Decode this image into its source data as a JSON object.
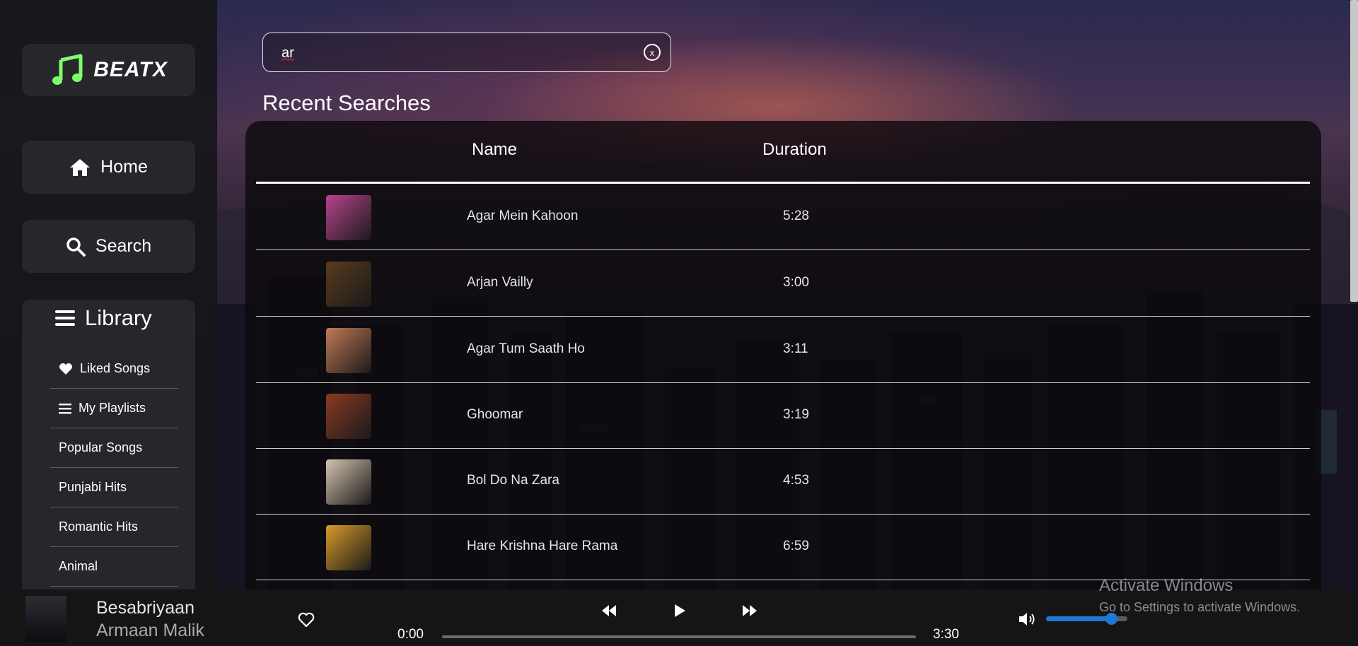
{
  "app": {
    "brand": "BEATX"
  },
  "sidebar": {
    "home_label": "Home",
    "search_label": "Search",
    "library_label": "Library",
    "library_items": [
      {
        "label": "Liked Songs",
        "icon": "heart-icon"
      },
      {
        "label": "My Playlists",
        "icon": "list-icon"
      },
      {
        "label": "Popular Songs"
      },
      {
        "label": "Punjabi Hits"
      },
      {
        "label": "Romantic Hits"
      },
      {
        "label": "Animal"
      }
    ]
  },
  "search": {
    "value": "ar",
    "clear_label": "x"
  },
  "recent": {
    "title": "Recent Searches",
    "columns": {
      "name": "Name",
      "duration": "Duration"
    },
    "rows": [
      {
        "name": "Agar Mein Kahoon",
        "duration": "5:28",
        "art_color": "#b8448c"
      },
      {
        "name": "Arjan Vailly",
        "duration": "3:00",
        "art_color": "#5a3a1e"
      },
      {
        "name": "Agar Tum Saath Ho",
        "duration": "3:11",
        "art_color": "#c07a55"
      },
      {
        "name": "Ghoomar",
        "duration": "3:19",
        "art_color": "#8a3a22"
      },
      {
        "name": "Bol Do Na Zara",
        "duration": "4:53",
        "art_color": "#d6c2b0"
      },
      {
        "name": "Hare Krishna Hare Rama",
        "duration": "6:59",
        "art_color": "#d89a2a"
      }
    ]
  },
  "player": {
    "title": "Besabriyaan",
    "artist": "Armaan Malik",
    "current_time": "0:00",
    "total_time": "3:30",
    "progress_fraction": 0.0,
    "volume_fraction": 0.8,
    "accent": "#1e79d6"
  },
  "watermark": {
    "line1": "Activate Windows",
    "line2": "Go to Settings to activate Windows."
  }
}
